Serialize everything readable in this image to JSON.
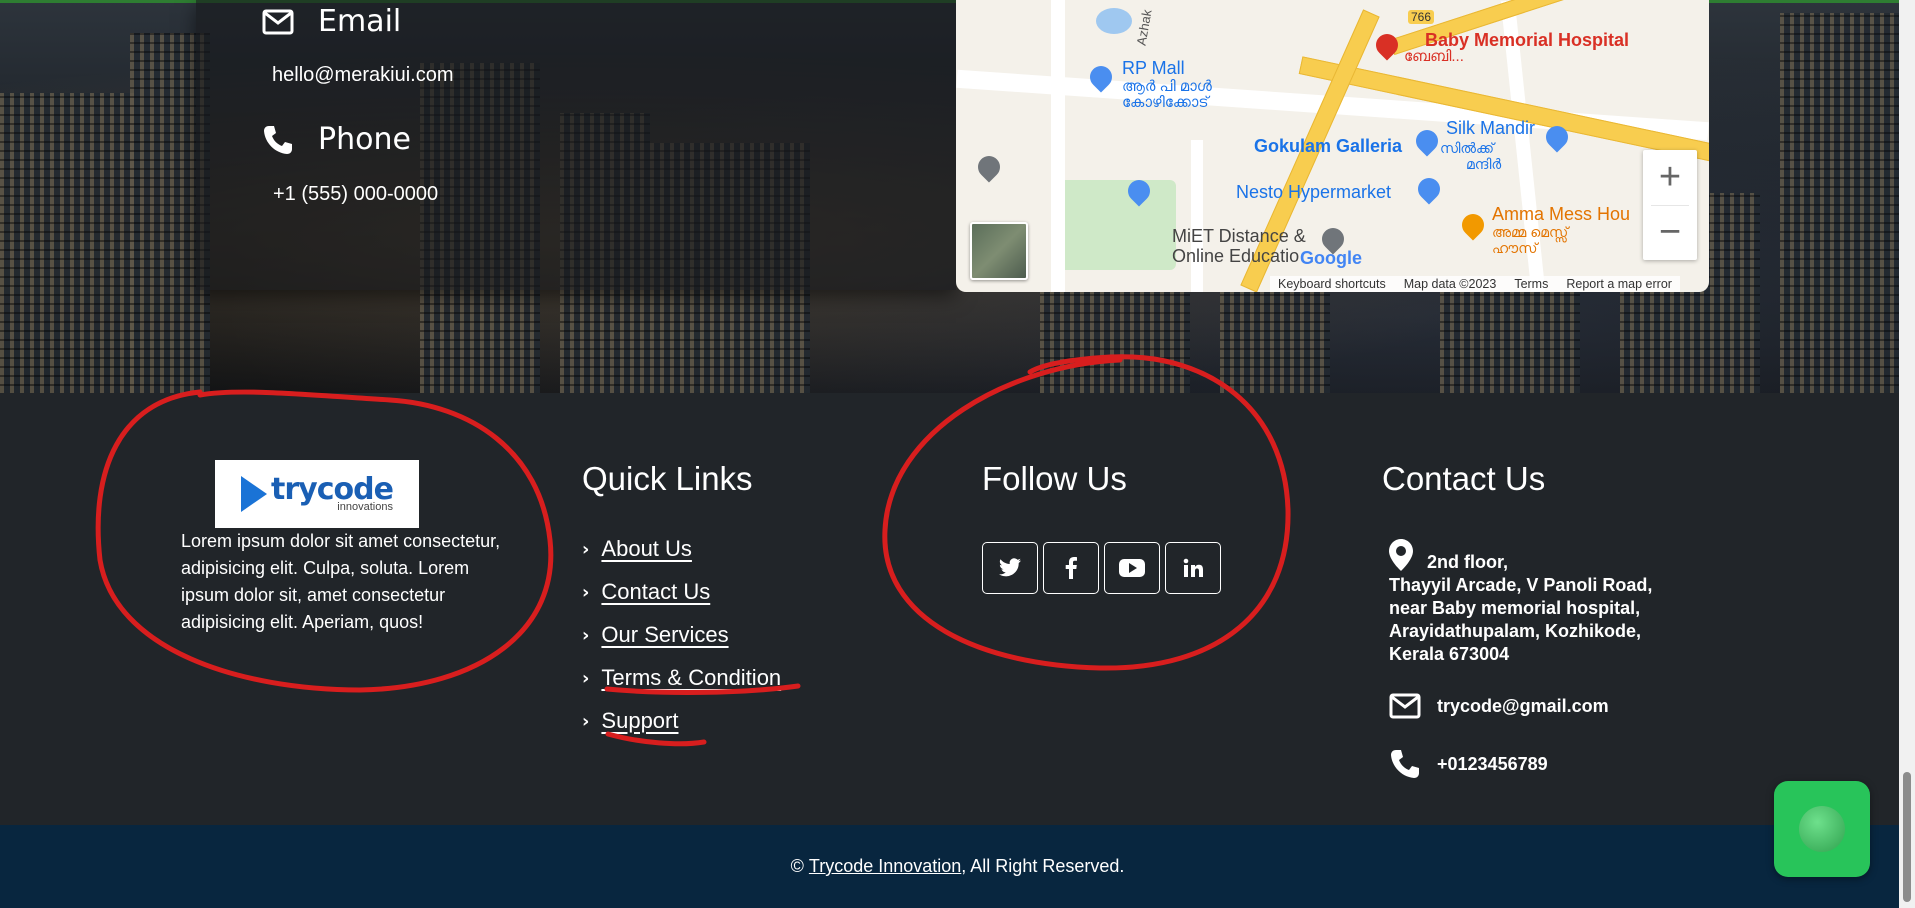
{
  "contact_card": {
    "email_label": "Email",
    "email_value": "hello@merakiui.com",
    "phone_label": "Phone",
    "phone_value": "+1 (555) 000-0000"
  },
  "map": {
    "places": [
      "Baby Memorial Hospital",
      "ബേബി...",
      "RP Mall",
      "ആർ പി മാൾ",
      "കോഴിക്കോട്",
      "Silk Mandir",
      "സിൽക്ക്",
      "മന്ദിർ",
      "Gokulam Galleria",
      "Nesto Hypermarket",
      "Amma Mess Hou",
      "അമ്മ മെസ്സ്",
      "ഹൗസ്",
      "MiET Distance &",
      "Online Educatio",
      "766",
      "Azhak"
    ],
    "logo": "Google",
    "footer_links": [
      "Keyboard shortcuts",
      "Map data ©2023",
      "Terms",
      "Report a map error"
    ],
    "zoom_in": "+",
    "zoom_out": "−"
  },
  "footer": {
    "logo_word": "trycode",
    "logo_sub": "innovations",
    "about_text": "Lorem ipsum dolor sit amet consectetur, adipisicing elit. Culpa, soluta. Lorem ipsum dolor sit, amet consectetur adipisicing elit. Aperiam, quos!",
    "quick_links_title": "Quick Links",
    "quick_links": [
      "About Us",
      "Contact Us",
      "Our Services",
      "Terms & Condition",
      "Support"
    ],
    "follow_title": "Follow Us",
    "social": [
      "twitter-icon",
      "facebook-icon",
      "youtube-icon",
      "linkedin-icon"
    ],
    "contact_title": "Contact Us",
    "address": [
      "2nd floor,",
      "Thayyil Arcade, V Panoli Road,",
      "near Baby memorial hospital,",
      "Arayidathupalam, Kozhikode,",
      "Kerala 673004"
    ],
    "email": "trycode@gmail.com",
    "phone": "+0123456789"
  },
  "bottom_bar": {
    "prefix": "© ",
    "link": "Trycode Innovation",
    "suffix": ", All Right Reserved."
  },
  "colors": {
    "footer_bg": "#212529",
    "bottom_bar_bg": "#08263f",
    "chat_button": "#28c45a",
    "annotation_red": "#d81e1e"
  }
}
